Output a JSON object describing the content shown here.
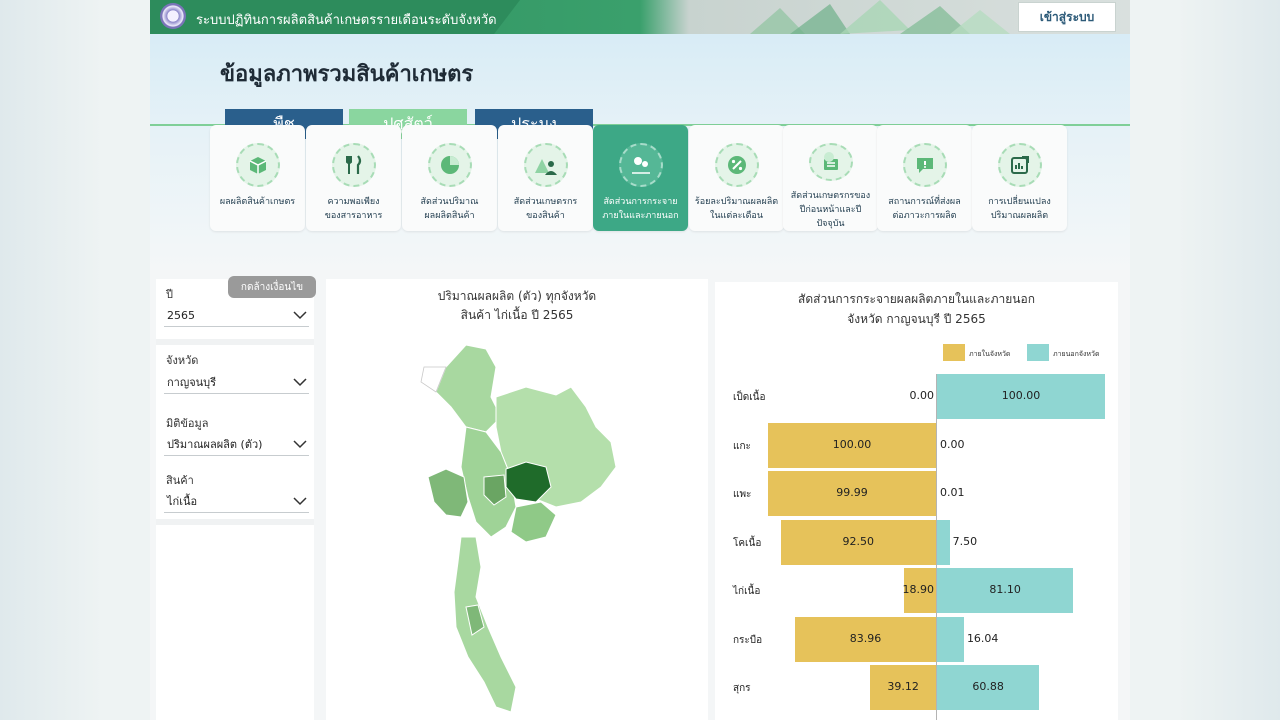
{
  "header": {
    "system_title": "ระบบปฏิทินการผลิตสินค้าเกษตรรายเดือนระดับจังหวัด",
    "login_label": "เข้าสู่ระบบ"
  },
  "page_title": "ข้อมูลภาพรวมสินค้าเกษตร",
  "tabs": [
    {
      "label": "พืช"
    },
    {
      "label": "ปศุสัตว์",
      "active": true
    },
    {
      "label": "ประมง"
    }
  ],
  "categories": [
    {
      "line1": "ผลผลิตสินค้าเกษตร",
      "line2": "",
      "icon": "box-icon"
    },
    {
      "line1": "ความพอเพียง",
      "line2": "ของสารอาหาร",
      "icon": "fork-knife-icon"
    },
    {
      "line1": "สัดส่วนปริมาณ",
      "line2": "ผลผลิตสินค้า",
      "icon": "pie-chart-icon"
    },
    {
      "line1": "สัดส่วนเกษตรกร",
      "line2": "ของสินค้า",
      "icon": "farmer-icon"
    },
    {
      "line1": "สัดส่วนการกระจาย",
      "line2": "ภายในและภายนอก",
      "icon": "map-pin-icon",
      "active": true
    },
    {
      "line1": "ร้อยละปริมาณผลผลิต",
      "line2": "ในแต่ละเดือน",
      "icon": "percent-icon"
    },
    {
      "line1": "สัดส่วนเกษตรกรของ",
      "line2": "ปีก่อนหน้าและปีปัจจุบัน",
      "icon": "calendar-chart-icon"
    },
    {
      "line1": "สถานการณ์ที่ส่งผล",
      "line2": "ต่อภาวะการผลิต",
      "icon": "chat-alert-icon"
    },
    {
      "line1": "การเปลี่ยนแปลง",
      "line2": "ปริมาณผลผลิต",
      "icon": "trend-chart-icon"
    }
  ],
  "filters": {
    "clear_label": "กดล้างเงื่อนไข",
    "year_label": "ปี",
    "year_value": "2565",
    "province_label": "จังหวัด",
    "province_value": "กาญจนบุรี",
    "dimension_label": "มิติข้อมูล",
    "dimension_value": "ปริมาณผลผลิต (ตัว)",
    "product_label": "สินค้า",
    "product_value": "ไก่เนื้อ"
  },
  "map": {
    "title_line1": "ปริมาณผลผลิต (ตัว) ทุกจังหวัด",
    "title_line2": "สินค้า ไก่เนื้อ ปี 2565"
  },
  "chart_data": {
    "type": "bar",
    "title": "สัดส่วนการกระจายผลผลิตภายในและภายนอก",
    "subtitle": "จังหวัด กาญจนบุรี ปี 2565",
    "categories": [
      "เป็ดเนื้อ",
      "แกะ",
      "แพะ",
      "โคเนื้อ",
      "ไก่เนื้อ",
      "กระบือ",
      "สุกร"
    ],
    "series": [
      {
        "name": "ภายในจังหวัด",
        "color": "#e6c25a",
        "values": [
          0.0,
          100.0,
          99.99,
          92.5,
          18.9,
          83.96,
          39.12
        ]
      },
      {
        "name": "ภายนอกจังหวัด",
        "color": "#8fd6d2",
        "values": [
          100.0,
          0.0,
          0.01,
          7.5,
          81.1,
          16.04,
          60.88
        ]
      }
    ],
    "value_labels": {
      "inside": [
        "0.00",
        "100.00",
        "99.99",
        "92.50",
        "18.90",
        "83.96",
        "39.12"
      ],
      "outside": [
        "100.00",
        "0.00",
        "0.01",
        "7.50",
        "81.10",
        "16.04",
        "60.88"
      ]
    },
    "xlim": [
      -100,
      100
    ],
    "legend": "top-right"
  }
}
